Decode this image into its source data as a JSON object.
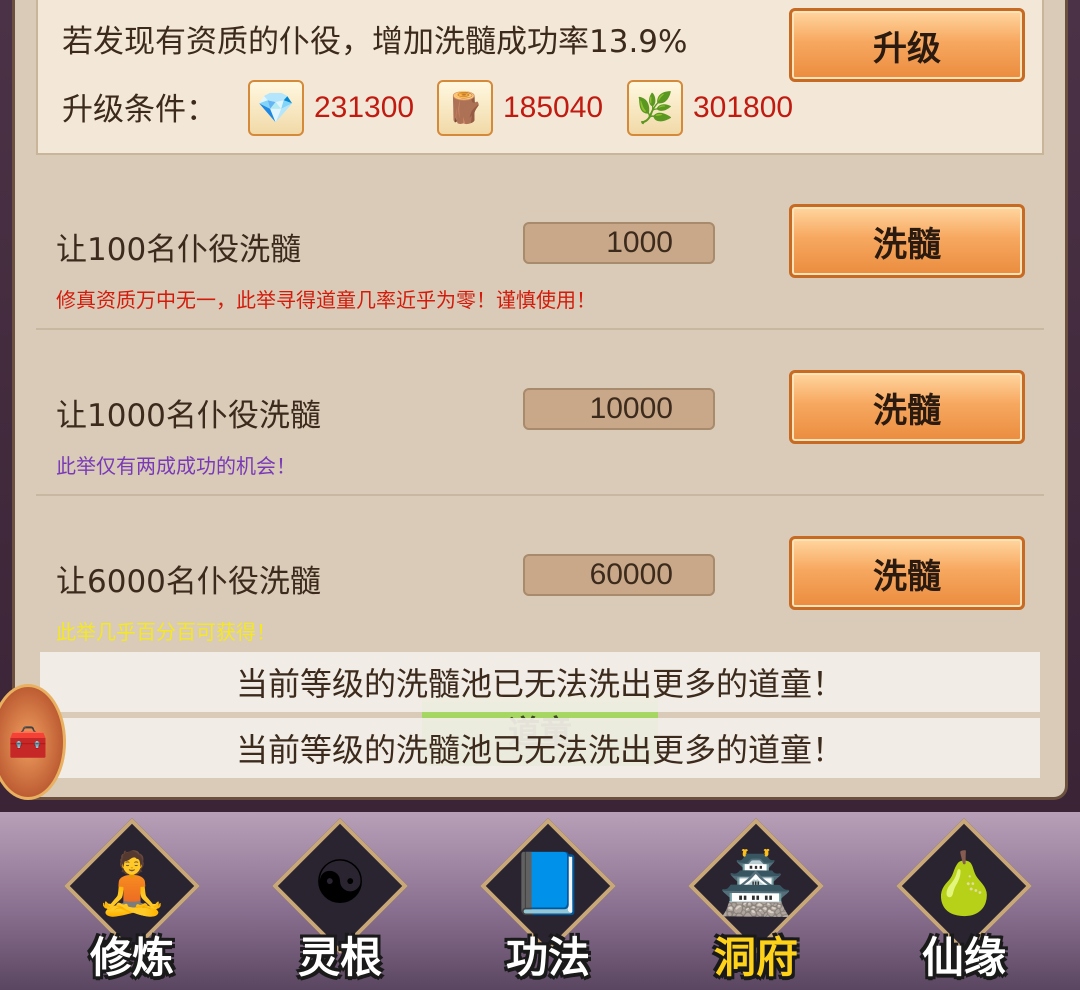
{
  "upgrade": {
    "description": "若发现有资质的仆役，增加洗髓成功率13.9%",
    "button_label": "升级",
    "conditions_label": "升级条件：",
    "resources": [
      {
        "icon": "stone-icon",
        "value": "231300"
      },
      {
        "icon": "wood-icon",
        "value": "185040"
      },
      {
        "icon": "herb-icon",
        "value": "301800"
      }
    ]
  },
  "wash_options": [
    {
      "title": "让100名仆役洗髓",
      "cost": "1000",
      "hint": "修真资质万中无一，此举寻得道童几率近乎为零！谨慎使用！",
      "hint_color": "#d41a0a",
      "button_label": "洗髓"
    },
    {
      "title": "让1000名仆役洗髓",
      "cost": "10000",
      "hint": "此举仅有两成成功的机会！",
      "hint_color": "#7a3ab8",
      "button_label": "洗髓"
    },
    {
      "title": "让6000名仆役洗髓",
      "cost": "60000",
      "hint": "此举几乎百分百可获得！",
      "hint_color": "#f5e820",
      "button_label": "洗髓"
    }
  ],
  "toasts": [
    "当前等级的洗髓池已无法洗出更多的道童！",
    "当前等级的洗髓池已无法洗出更多的道童！"
  ],
  "green_tab_label": "道童",
  "bottom_nav": [
    {
      "label": "修炼",
      "icon": "monk-icon",
      "active": false
    },
    {
      "label": "灵根",
      "icon": "yin-yang-sword-icon",
      "active": false
    },
    {
      "label": "功法",
      "icon": "book-icon",
      "active": false
    },
    {
      "label": "洞府",
      "icon": "palace-icon",
      "active": true
    },
    {
      "label": "仙缘",
      "icon": "gourd-icon",
      "active": false
    }
  ]
}
